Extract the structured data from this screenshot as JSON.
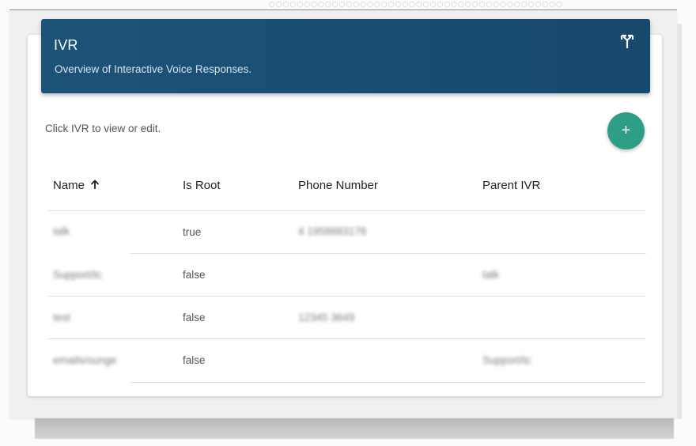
{
  "header": {
    "title": "IVR",
    "subtitle": "Overview of Interactive Voice Responses.",
    "icon": "call-split-icon"
  },
  "toolbar": {
    "hint": "Click IVR to view or edit.",
    "add_label": "+",
    "add_icon": "plus-icon"
  },
  "table": {
    "columns": [
      "Name",
      "Is Root",
      "Phone Number",
      "Parent IVR"
    ],
    "sort_icon": "arrow-up-icon",
    "rows": [
      {
        "name": "talk",
        "is_root": "true",
        "phone": "4 1958883176",
        "parent": ""
      },
      {
        "name": "Support/tc",
        "is_root": "false",
        "phone": "",
        "parent": "talk"
      },
      {
        "name": "test",
        "is_root": "false",
        "phone": "12345 3649",
        "parent": ""
      },
      {
        "name": "emails/ounge",
        "is_root": "false",
        "phone": "",
        "parent": "Support/tc"
      }
    ]
  },
  "colors": {
    "header_bg": "#1b4f72",
    "add_button": "#2e9f86"
  }
}
